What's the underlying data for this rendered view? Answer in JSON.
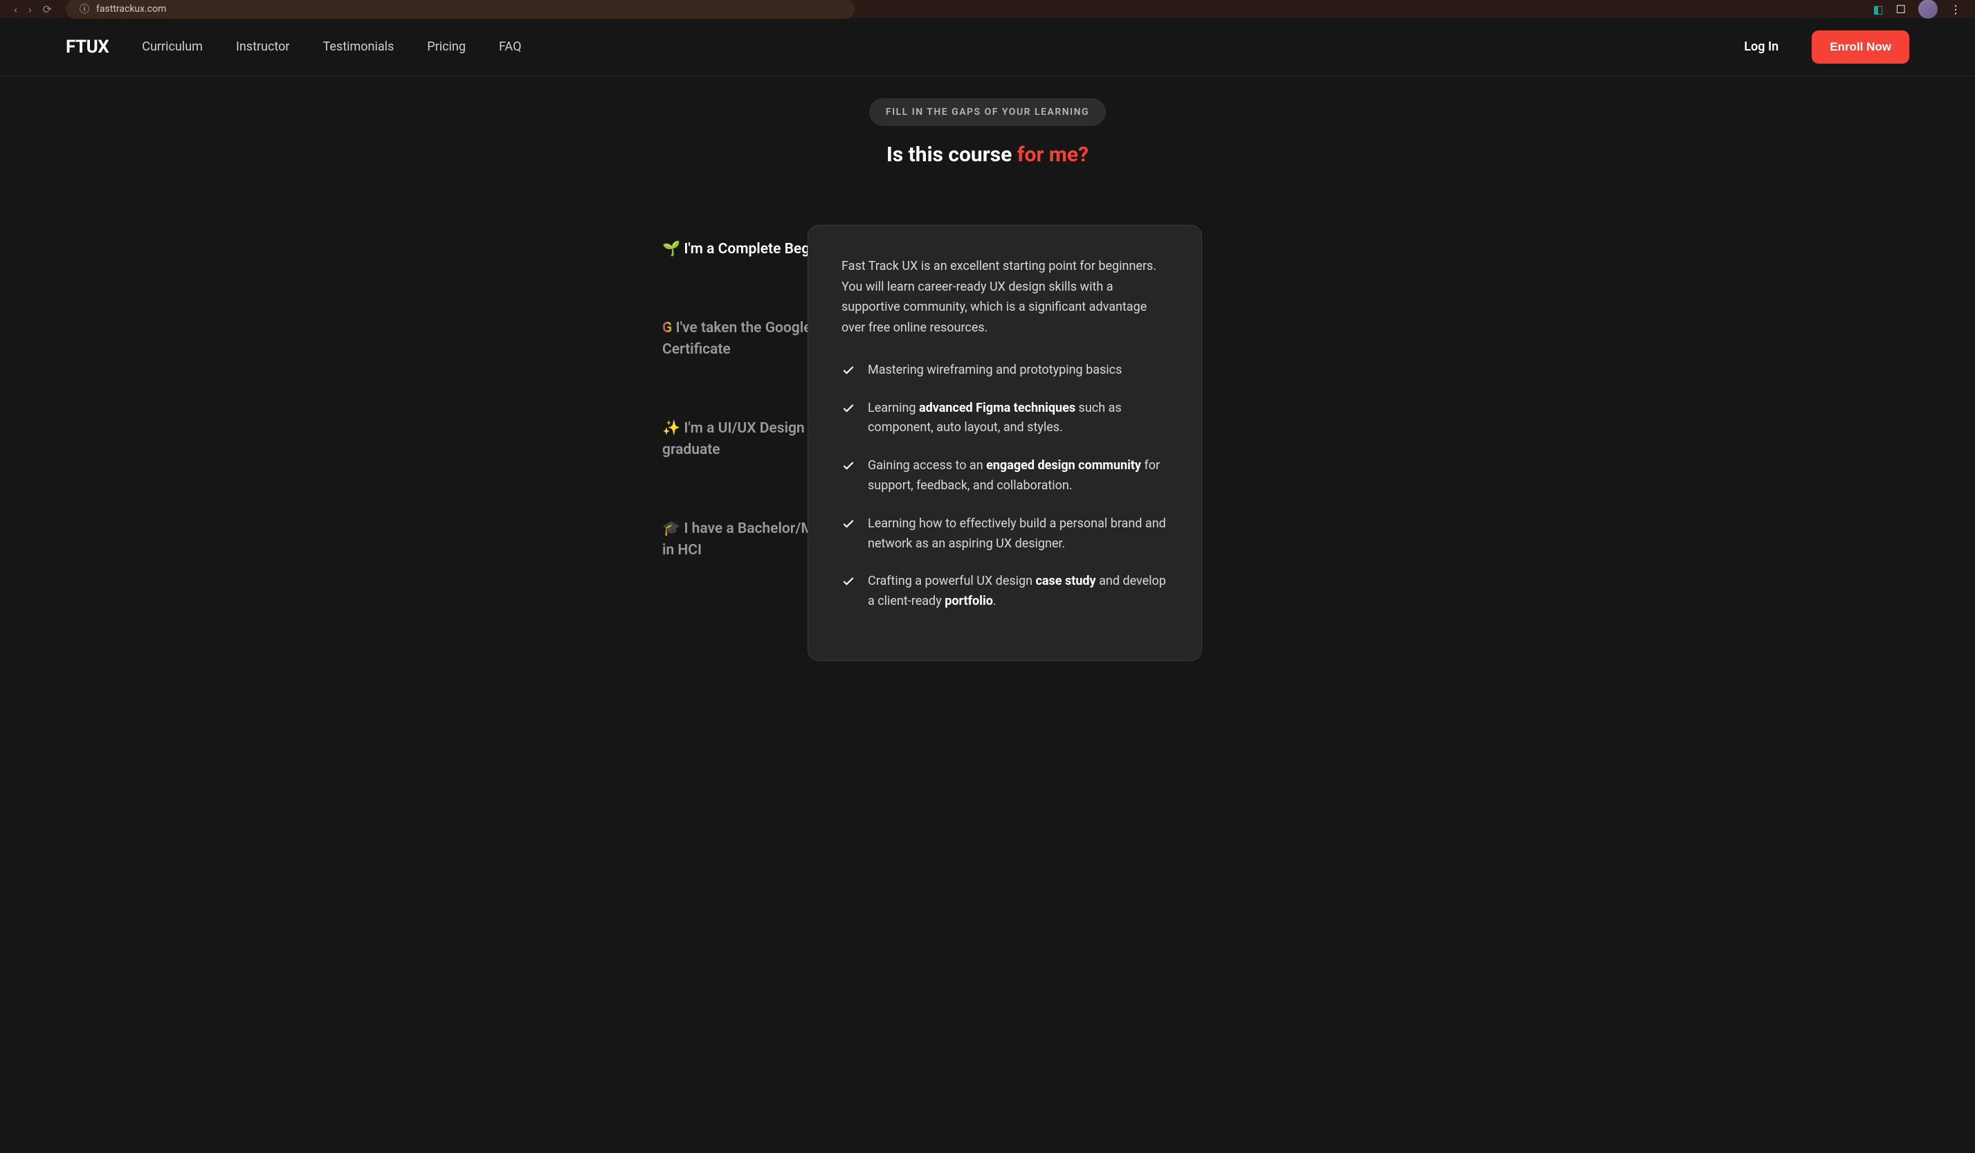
{
  "browser": {
    "url": "fasttrackux.com"
  },
  "nav": {
    "logo": "FTUX",
    "links": [
      "Curriculum",
      "Instructor",
      "Testimonials",
      "Pricing",
      "FAQ"
    ],
    "login": "Log In",
    "enroll": "Enroll Now"
  },
  "hero": {
    "pill": "FILL IN THE GAPS OF YOUR LEARNING",
    "headline_plain": "Is this course ",
    "headline_accent": "for me?"
  },
  "tabs": [
    {
      "emoji": "🌱",
      "label": "I'm a Complete Beginner",
      "active": true
    },
    {
      "emoji": "G",
      "label": "I've taken the Google UX Certificate",
      "active": false
    },
    {
      "emoji": "✨",
      "label": "I'm a UI/UX Design Bootcamp graduate",
      "active": false
    },
    {
      "emoji": "🎓",
      "label": "I have a Bachelor/Master Degree in HCI",
      "active": false
    }
  ],
  "panel": {
    "intro": "Fast Track UX is an excellent starting point for beginners. You will learn career-ready UX design skills with a supportive community, which is a significant advantage over free online resources.",
    "items": [
      {
        "parts": [
          {
            "t": "Mastering wireframing and prototyping basics",
            "b": false
          }
        ]
      },
      {
        "parts": [
          {
            "t": "Learning ",
            "b": false
          },
          {
            "t": "advanced Figma techniques",
            "b": true
          },
          {
            "t": " such as component, auto layout, and styles.",
            "b": false
          }
        ]
      },
      {
        "parts": [
          {
            "t": "Gaining access to an ",
            "b": false
          },
          {
            "t": "engaged design community",
            "b": true
          },
          {
            "t": " for support, feedback, and collaboration.",
            "b": false
          }
        ]
      },
      {
        "parts": [
          {
            "t": "Learning how to effectively build a personal brand and network as an aspiring UX designer.",
            "b": false
          }
        ]
      },
      {
        "parts": [
          {
            "t": "Crafting a powerful UX design ",
            "b": false
          },
          {
            "t": "case study",
            "b": true
          },
          {
            "t": " and develop a client-ready ",
            "b": false
          },
          {
            "t": "portfolio",
            "b": true
          },
          {
            "t": ".",
            "b": false
          }
        ]
      }
    ]
  }
}
